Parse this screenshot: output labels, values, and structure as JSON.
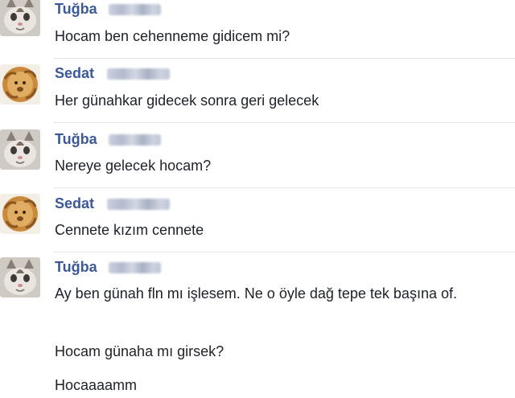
{
  "conversation": {
    "messages": [
      {
        "sender": "Tuğba",
        "avatar": "cat-avatar-icon",
        "lines": [
          "Hocam ben cehenneme gidicem mi?"
        ]
      },
      {
        "sender": "Sedat",
        "avatar": "lion-avatar-icon",
        "lines": [
          "Her günahkar gidecek sonra geri gelecek"
        ]
      },
      {
        "sender": "Tuğba",
        "avatar": "cat-avatar-icon",
        "lines": [
          "Nereye gelecek hocam?"
        ]
      },
      {
        "sender": "Sedat",
        "avatar": "lion-avatar-icon",
        "lines": [
          "Cennete kızım cennete"
        ]
      },
      {
        "sender": "Tuğba",
        "avatar": "cat-avatar-icon",
        "lines": [
          "Ay ben günah fln mı işlesem. Ne o öyle dağ tepe tek başına of.",
          "Hocam günaha mı girsek?",
          "Hocaaaamm"
        ]
      }
    ]
  },
  "colors": {
    "sender_name": "#3b5998",
    "message_text": "#1d2129",
    "divider": "#e5e6e9"
  }
}
